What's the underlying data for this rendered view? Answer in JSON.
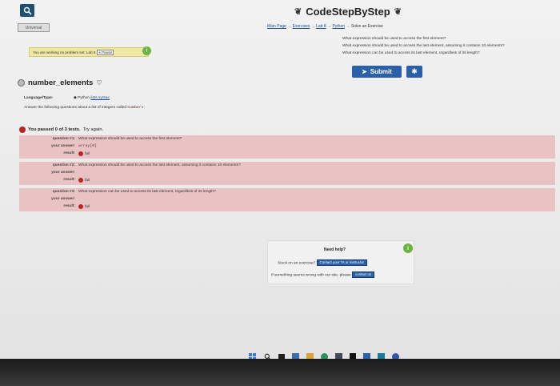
{
  "site": {
    "title": "CodeStepByStep",
    "main_link": "Universal"
  },
  "breadcrumb": {
    "items": [
      "Main Page",
      "Exercises",
      "Lab 8",
      "Python"
    ],
    "separator": "→",
    "current": "Solve an Exercise"
  },
  "questions_panel": {
    "lines": [
      "What expression should be used to access the first element?",
      "What expression should be used to access the last element, assuming it contains 10 elements?",
      "What expression can be used to access its last element, regardless of its length?"
    ]
  },
  "toolbar": {
    "submit_label": "Submit",
    "settings_icon": "gear-icon"
  },
  "notice": {
    "text": "You are working on problem set: Lab 8",
    "pause_label": "Pause"
  },
  "problem": {
    "title": "number_elements",
    "language_label": "Language/Type:",
    "language_value": "Python",
    "topic_value": "lists syntax",
    "description_prefix": "Answer the following questions about a list of integers called",
    "variable_name": "numbers",
    "description_suffix": ":"
  },
  "results": {
    "summary": "You passed 0 of 3 tests.",
    "try_again": "Try again.",
    "labels": {
      "q1": "question #1:",
      "q2": "question #2:",
      "q3": "question #3:",
      "answer": "your answer:",
      "result": "result:"
    },
    "tests": [
      {
        "question": "What expression should be used to access the first element?",
        "answer": "array[0]",
        "result": "fail"
      },
      {
        "question": "What expression should be used to access the last element, assuming it contains 10 elements?",
        "answer": "",
        "result": "fail"
      },
      {
        "question": "What expression can be used to access its last element, regardless of its length?",
        "answer": "",
        "result": "fail"
      }
    ]
  },
  "help": {
    "title": "Need help?",
    "stuck_text": "Stuck on an exercise?",
    "contact_ta_label": "Contact your TA or instructor",
    "wrong_text": "If something seems wrong with our site, please",
    "contact_label": "contact us"
  },
  "colors": {
    "fail_row": "#e9c3c3",
    "accent": "#2b5fa8",
    "info_green": "#6db33f",
    "notice_yellow": "#efe7a4"
  }
}
